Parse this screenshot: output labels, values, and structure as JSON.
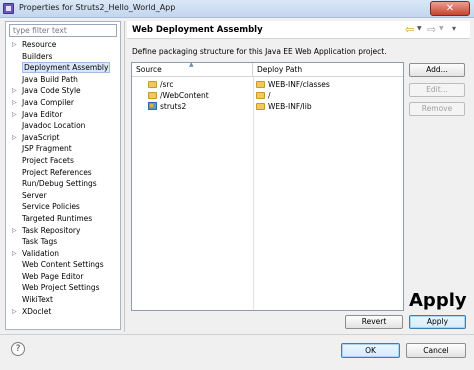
{
  "window": {
    "title": "Properties for Struts2_Hello_World_App",
    "close_glyph": "✕"
  },
  "filter": {
    "placeholder": "type filter text"
  },
  "tree": [
    {
      "label": "Resource",
      "expandable": true,
      "selected": false
    },
    {
      "label": "Builders",
      "expandable": false,
      "selected": false
    },
    {
      "label": "Deployment Assembly",
      "expandable": false,
      "selected": true
    },
    {
      "label": "Java Build Path",
      "expandable": false,
      "selected": false
    },
    {
      "label": "Java Code Style",
      "expandable": true,
      "selected": false
    },
    {
      "label": "Java Compiler",
      "expandable": true,
      "selected": false
    },
    {
      "label": "Java Editor",
      "expandable": true,
      "selected": false
    },
    {
      "label": "Javadoc Location",
      "expandable": false,
      "selected": false
    },
    {
      "label": "JavaScript",
      "expandable": true,
      "selected": false
    },
    {
      "label": "JSP Fragment",
      "expandable": false,
      "selected": false
    },
    {
      "label": "Project Facets",
      "expandable": false,
      "selected": false
    },
    {
      "label": "Project References",
      "expandable": false,
      "selected": false
    },
    {
      "label": "Run/Debug Settings",
      "expandable": false,
      "selected": false
    },
    {
      "label": "Server",
      "expandable": false,
      "selected": false
    },
    {
      "label": "Service Policies",
      "expandable": false,
      "selected": false
    },
    {
      "label": "Targeted Runtimes",
      "expandable": false,
      "selected": false
    },
    {
      "label": "Task Repository",
      "expandable": true,
      "selected": false
    },
    {
      "label": "Task Tags",
      "expandable": false,
      "selected": false
    },
    {
      "label": "Validation",
      "expandable": true,
      "selected": false
    },
    {
      "label": "Web Content Settings",
      "expandable": false,
      "selected": false
    },
    {
      "label": "Web Page Editor",
      "expandable": false,
      "selected": false
    },
    {
      "label": "Web Project Settings",
      "expandable": false,
      "selected": false
    },
    {
      "label": "WikiText",
      "expandable": false,
      "selected": false
    },
    {
      "label": "XDoclet",
      "expandable": true,
      "selected": false
    }
  ],
  "page": {
    "title": "Web Deployment Assembly",
    "description": "Define packaging structure for this Java EE Web Application project."
  },
  "table": {
    "columns": [
      "Source",
      "Deploy Path"
    ],
    "rows": [
      {
        "source": "/src",
        "deploy_path": "WEB-INF/classes",
        "icon": "folder-icon"
      },
      {
        "source": "/WebContent",
        "deploy_path": "/",
        "icon": "folder-icon"
      },
      {
        "source": "struts2",
        "deploy_path": "WEB-INF/lib",
        "icon": "project-icon"
      }
    ]
  },
  "buttons": {
    "add": "Add...",
    "edit": "Edit...",
    "remove": "Remove",
    "revert": "Revert",
    "apply": "Apply",
    "ok": "OK",
    "cancel": "Cancel"
  },
  "annotation": {
    "text": "Apply"
  },
  "nav_icons": {
    "back": "back-arrow-icon",
    "forward": "forward-arrow-icon",
    "menu": "view-menu-icon"
  },
  "colors": {
    "selection": "#d8e6f8",
    "close": "#c7432f",
    "default_button_border": "#3c7fb1"
  }
}
